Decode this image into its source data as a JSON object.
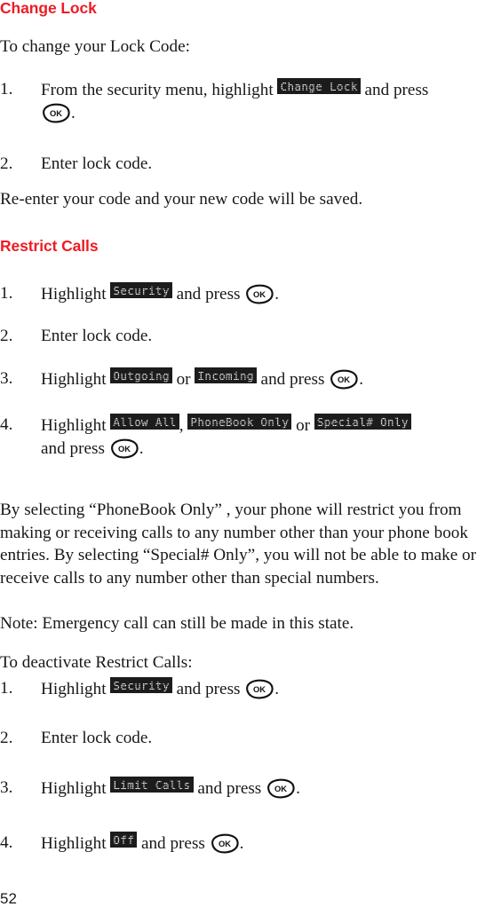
{
  "page": {
    "number": "52"
  },
  "sections": [
    {
      "heading": "Change Lock",
      "intro": "To change your Lock Code:",
      "steps": [
        {
          "num": "1.",
          "text_before": "From the security menu, highlight",
          "lcd": "Change Lock",
          "text_after": "and press",
          "trailing": "."
        },
        {
          "num": "2.",
          "text_before": "Enter lock code.",
          "lcd": "",
          "text_after": "",
          "trailing": ""
        }
      ],
      "outro": "Re-enter your code and your new code will be saved."
    },
    {
      "heading": "Restrict Calls",
      "steps": [
        {
          "num": "1.",
          "text_before": "Highlight",
          "lcd": "Security",
          "text_after": "and press",
          "trailing": "."
        },
        {
          "num": "2.",
          "text_before": "Enter lock code.",
          "lcd": "",
          "text_after": "",
          "trailing": ""
        },
        {
          "num": "3.",
          "text_before": "Highlight",
          "lcd": "Outgoing",
          "conjunction": "or",
          "lcd2": "Incoming",
          "text_after": "and press",
          "trailing": "."
        },
        {
          "num": "4.",
          "text_before": "Highlight",
          "lcd": "Allow All",
          "separator": ",",
          "lcd2": "PhoneBook Only",
          "conjunction": "or",
          "lcd3": "Special# Only",
          "text_after": "and press",
          "trailing": "."
        }
      ],
      "paragraph": "By selecting “PhoneBook Only” , your phone will restrict you from making or receiving calls to any number other than your phone book entries. By selecting “Special# Only”,  you will not be able to make or receive calls to any number other than special numbers.",
      "note": "Note: Emergency call can still be made in this state.",
      "deactivate_intro": "To deactivate Restrict Calls:",
      "deactivate_steps": [
        {
          "num": "1.",
          "text_before": "Highlight",
          "lcd": "Security",
          "text_after": "and press",
          "trailing": "."
        },
        {
          "num": "2.",
          "text_before": "Enter lock code.",
          "lcd": "",
          "text_after": "",
          "trailing": ""
        },
        {
          "num": "3.",
          "text_before": "Highlight",
          "lcd": "Limit Calls",
          "text_after": "and press",
          "trailing": "."
        },
        {
          "num": "4.",
          "text_before": "Highlight",
          "lcd": "Off",
          "text_after": "and press",
          "trailing": "."
        }
      ]
    }
  ],
  "glyphs": {
    "ok_key_label": "OK"
  },
  "colors": {
    "heading": "#ED1C24",
    "body": "#181818",
    "lcd_background": "#1c1c1c",
    "lcd_text": "#ffffff"
  }
}
